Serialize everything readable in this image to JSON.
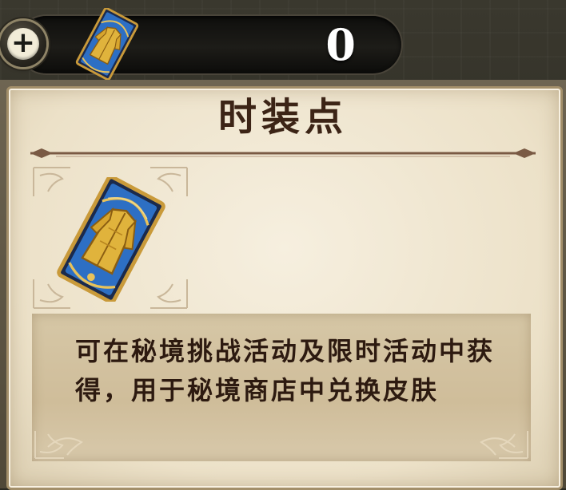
{
  "currency": {
    "icon": "costume-card-icon",
    "amount": "0"
  },
  "panel": {
    "title": "时装点",
    "icon": "costume-card-icon",
    "description": "可在秘境挑战活动及限时活动中获得，用于秘境商店中兑换皮肤"
  },
  "colors": {
    "title": "#3c2416",
    "parchment": "#efe4cc",
    "card_blue": "#2d6fc4",
    "card_gold": "#e0b33c"
  }
}
